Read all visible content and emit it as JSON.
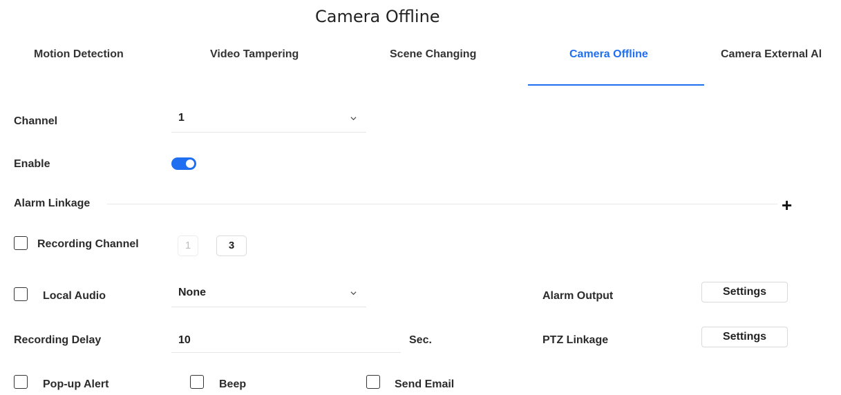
{
  "page": {
    "title": "Camera Offline"
  },
  "tabs": [
    {
      "label": "Motion Detection",
      "active": false
    },
    {
      "label": "Video Tampering",
      "active": false
    },
    {
      "label": "Scene Changing",
      "active": false
    },
    {
      "label": "Camera Offline",
      "active": true
    },
    {
      "label": "Camera External Al",
      "active": false
    }
  ],
  "form": {
    "channel_label": "Channel",
    "channel_value": "1",
    "enable_label": "Enable",
    "enable_on": true,
    "alarm_linkage_label": "Alarm Linkage",
    "recording_channel_label": "Recording Channel",
    "recording_channels": [
      "1",
      "3"
    ],
    "local_audio_label": "Local Audio",
    "local_audio_value": "None",
    "alarm_output_label": "Alarm Output",
    "alarm_output_button": "Settings",
    "recording_delay_label": "Recording Delay",
    "recording_delay_value": "10",
    "recording_delay_unit": "Sec.",
    "ptz_linkage_label": "PTZ Linkage",
    "ptz_linkage_button": "Settings",
    "popup_alert_label": "Pop-up Alert",
    "beep_label": "Beep",
    "send_email_label": "Send Email"
  },
  "colors": {
    "accent": "#1f6ff0"
  }
}
